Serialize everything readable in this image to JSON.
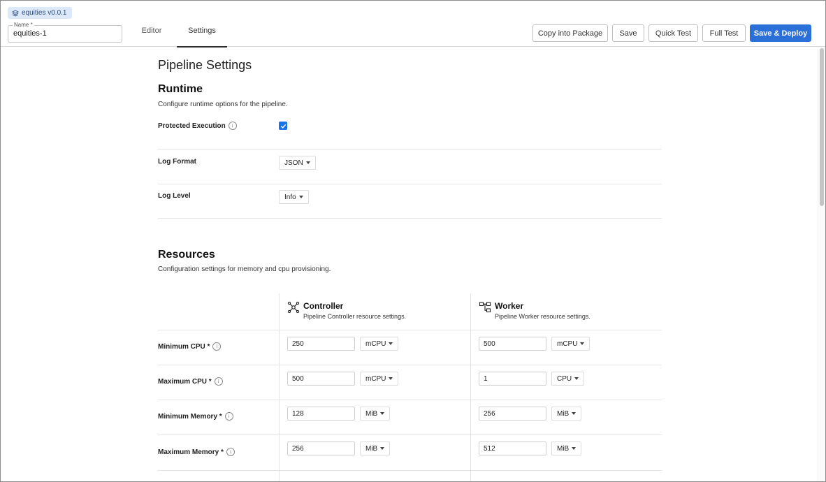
{
  "header": {
    "package_badge": "equities v0.0.1",
    "name_label": "Name *",
    "name_value": "equities-1",
    "tabs": [
      {
        "label": "Editor",
        "active": false
      },
      {
        "label": "Settings",
        "active": true
      }
    ],
    "buttons": {
      "copy": "Copy into Package",
      "save": "Save",
      "quick_test": "Quick Test",
      "full_test": "Full Test",
      "deploy": "Save & Deploy"
    }
  },
  "page": {
    "title": "Pipeline Settings"
  },
  "runtime": {
    "title": "Runtime",
    "description": "Configure runtime options for the pipeline.",
    "protected_execution": {
      "label": "Protected Execution",
      "checked": true
    },
    "log_format": {
      "label": "Log Format",
      "value": "JSON"
    },
    "log_level": {
      "label": "Log Level",
      "value": "Info"
    }
  },
  "resources": {
    "title": "Resources",
    "description": "Configuration settings for memory and cpu provisioning.",
    "controller": {
      "title": "Controller",
      "subtitle": "Pipeline Controller resource settings.",
      "icon": "network-nodes-icon"
    },
    "worker": {
      "title": "Worker",
      "subtitle": "Pipeline Worker resource settings.",
      "icon": "hierarchy-icon"
    },
    "rows": [
      {
        "label": "Minimum CPU *",
        "controller_value": "250",
        "controller_unit": "mCPU",
        "worker_value": "500",
        "worker_unit": "mCPU"
      },
      {
        "label": "Maximum CPU *",
        "controller_value": "500",
        "controller_unit": "mCPU",
        "worker_value": "1",
        "worker_unit": "CPU"
      },
      {
        "label": "Minimum Memory *",
        "controller_value": "128",
        "controller_unit": "MiB",
        "worker_value": "256",
        "worker_unit": "MiB"
      },
      {
        "label": "Maximum Memory *",
        "controller_value": "256",
        "controller_unit": "MiB",
        "worker_value": "512",
        "worker_unit": "MiB"
      }
    ]
  },
  "colors": {
    "primary": "#2b6fd9",
    "checkbox": "#1b73e8",
    "badge_bg": "#dde8f8"
  }
}
